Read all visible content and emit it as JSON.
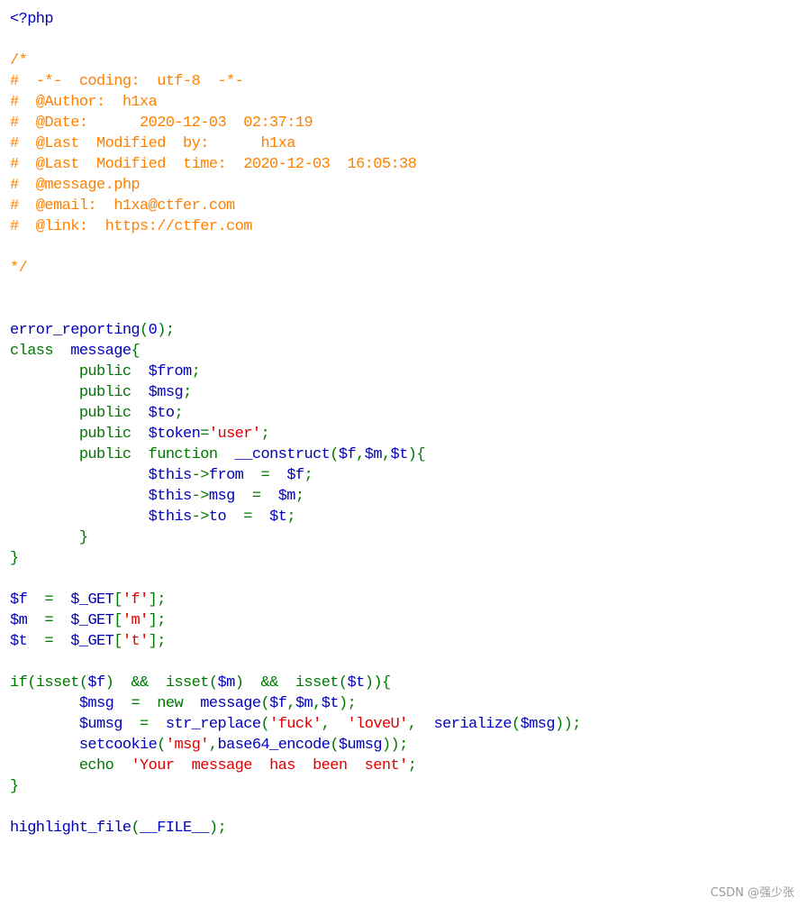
{
  "colors": {
    "default": "#0000BB",
    "keyword": "#007700",
    "string": "#DD0000",
    "comment": "#FF8000",
    "html": "#000000"
  },
  "source_file": {
    "language": "php",
    "lines": [
      [
        [
          "default",
          "<?php"
        ]
      ],
      [],
      [
        [
          "comment",
          "/*"
        ]
      ],
      [
        [
          "comment",
          "#  -*-  coding:  utf-8  -*-"
        ]
      ],
      [
        [
          "comment",
          "#  @Author:  h1xa"
        ]
      ],
      [
        [
          "comment",
          "#  @Date:      2020-12-03  02:37:19"
        ]
      ],
      [
        [
          "comment",
          "#  @Last  Modified  by:      h1xa"
        ]
      ],
      [
        [
          "comment",
          "#  @Last  Modified  time:  2020-12-03  16:05:38"
        ]
      ],
      [
        [
          "comment",
          "#  @message.php"
        ]
      ],
      [
        [
          "comment",
          "#  @email:  h1xa@ctfer.com"
        ]
      ],
      [
        [
          "comment",
          "#  @link:  https://ctfer.com"
        ]
      ],
      [],
      [
        [
          "comment",
          "*/"
        ]
      ],
      [],
      [],
      [
        [
          "default",
          "error_reporting"
        ],
        [
          "keyword",
          "("
        ],
        [
          "default",
          "0"
        ],
        [
          "keyword",
          ");"
        ]
      ],
      [
        [
          "keyword",
          "class  "
        ],
        [
          "default",
          "message"
        ],
        [
          "keyword",
          "{"
        ]
      ],
      [
        [
          "keyword",
          "        public  "
        ],
        [
          "default",
          "$from"
        ],
        [
          "keyword",
          ";"
        ]
      ],
      [
        [
          "keyword",
          "        public  "
        ],
        [
          "default",
          "$msg"
        ],
        [
          "keyword",
          ";"
        ]
      ],
      [
        [
          "keyword",
          "        public  "
        ],
        [
          "default",
          "$to"
        ],
        [
          "keyword",
          ";"
        ]
      ],
      [
        [
          "keyword",
          "        public  "
        ],
        [
          "default",
          "$token"
        ],
        [
          "keyword",
          "="
        ],
        [
          "string",
          "'user'"
        ],
        [
          "keyword",
          ";"
        ]
      ],
      [
        [
          "keyword",
          "        public  function  "
        ],
        [
          "default",
          "__construct"
        ],
        [
          "keyword",
          "("
        ],
        [
          "default",
          "$f"
        ],
        [
          "keyword",
          ","
        ],
        [
          "default",
          "$m"
        ],
        [
          "keyword",
          ","
        ],
        [
          "default",
          "$t"
        ],
        [
          "keyword",
          "){"
        ]
      ],
      [
        [
          "keyword",
          "                "
        ],
        [
          "default",
          "$this"
        ],
        [
          "keyword",
          "->"
        ],
        [
          "default",
          "from  "
        ],
        [
          "keyword",
          "=  "
        ],
        [
          "default",
          "$f"
        ],
        [
          "keyword",
          ";"
        ]
      ],
      [
        [
          "keyword",
          "                "
        ],
        [
          "default",
          "$this"
        ],
        [
          "keyword",
          "->"
        ],
        [
          "default",
          "msg  "
        ],
        [
          "keyword",
          "=  "
        ],
        [
          "default",
          "$m"
        ],
        [
          "keyword",
          ";"
        ]
      ],
      [
        [
          "keyword",
          "                "
        ],
        [
          "default",
          "$this"
        ],
        [
          "keyword",
          "->"
        ],
        [
          "default",
          "to  "
        ],
        [
          "keyword",
          "=  "
        ],
        [
          "default",
          "$t"
        ],
        [
          "keyword",
          ";"
        ]
      ],
      [
        [
          "keyword",
          "        }"
        ]
      ],
      [
        [
          "keyword",
          "}"
        ]
      ],
      [],
      [
        [
          "default",
          "$f  "
        ],
        [
          "keyword",
          "=  "
        ],
        [
          "default",
          "$_GET"
        ],
        [
          "keyword",
          "["
        ],
        [
          "string",
          "'f'"
        ],
        [
          "keyword",
          "];"
        ]
      ],
      [
        [
          "default",
          "$m  "
        ],
        [
          "keyword",
          "=  "
        ],
        [
          "default",
          "$_GET"
        ],
        [
          "keyword",
          "["
        ],
        [
          "string",
          "'m'"
        ],
        [
          "keyword",
          "];"
        ]
      ],
      [
        [
          "default",
          "$t  "
        ],
        [
          "keyword",
          "=  "
        ],
        [
          "default",
          "$_GET"
        ],
        [
          "keyword",
          "["
        ],
        [
          "string",
          "'t'"
        ],
        [
          "keyword",
          "];"
        ]
      ],
      [],
      [
        [
          "keyword",
          "if(isset("
        ],
        [
          "default",
          "$f"
        ],
        [
          "keyword",
          ")  &&  isset("
        ],
        [
          "default",
          "$m"
        ],
        [
          "keyword",
          ")  &&  isset("
        ],
        [
          "default",
          "$t"
        ],
        [
          "keyword",
          ")){"
        ]
      ],
      [
        [
          "keyword",
          "        "
        ],
        [
          "default",
          "$msg  "
        ],
        [
          "keyword",
          "=  new  "
        ],
        [
          "default",
          "message"
        ],
        [
          "keyword",
          "("
        ],
        [
          "default",
          "$f"
        ],
        [
          "keyword",
          ","
        ],
        [
          "default",
          "$m"
        ],
        [
          "keyword",
          ","
        ],
        [
          "default",
          "$t"
        ],
        [
          "keyword",
          ");"
        ]
      ],
      [
        [
          "keyword",
          "        "
        ],
        [
          "default",
          "$umsg  "
        ],
        [
          "keyword",
          "=  "
        ],
        [
          "default",
          "str_replace"
        ],
        [
          "keyword",
          "("
        ],
        [
          "string",
          "'fuck'"
        ],
        [
          "keyword",
          ",  "
        ],
        [
          "string",
          "'loveU'"
        ],
        [
          "keyword",
          ",  "
        ],
        [
          "default",
          "serialize"
        ],
        [
          "keyword",
          "("
        ],
        [
          "default",
          "$msg"
        ],
        [
          "keyword",
          "));"
        ]
      ],
      [
        [
          "keyword",
          "        "
        ],
        [
          "default",
          "setcookie"
        ],
        [
          "keyword",
          "("
        ],
        [
          "string",
          "'msg'"
        ],
        [
          "keyword",
          ","
        ],
        [
          "default",
          "base64_encode"
        ],
        [
          "keyword",
          "("
        ],
        [
          "default",
          "$umsg"
        ],
        [
          "keyword",
          "));"
        ]
      ],
      [
        [
          "keyword",
          "        echo  "
        ],
        [
          "string",
          "'Your  message  has  been  sent'"
        ],
        [
          "keyword",
          ";"
        ]
      ],
      [
        [
          "keyword",
          "}"
        ]
      ],
      [],
      [
        [
          "default",
          "highlight_file"
        ],
        [
          "keyword",
          "("
        ],
        [
          "default",
          "__FILE__"
        ],
        [
          "keyword",
          ");"
        ]
      ]
    ]
  },
  "watermark": "CSDN @强少张"
}
